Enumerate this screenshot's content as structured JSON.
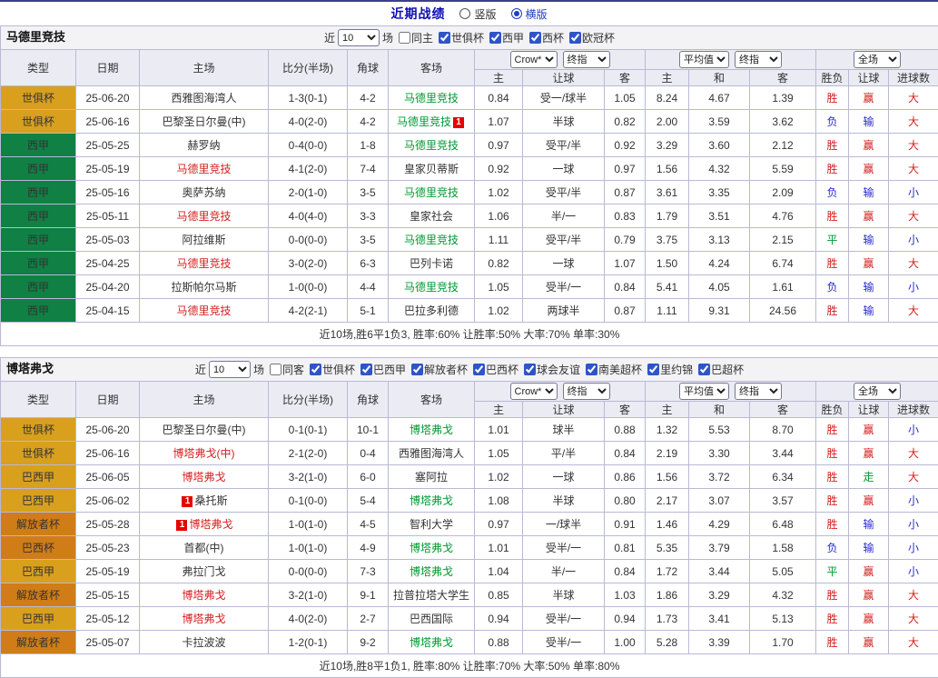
{
  "page": {
    "title": "近期战绩",
    "views": [
      {
        "label": "竖版",
        "selected": false
      },
      {
        "label": "横版",
        "selected": true
      }
    ]
  },
  "header": {
    "col_labels": [
      "类型",
      "日期",
      "主场",
      "比分(半场)",
      "角球",
      "客场"
    ],
    "sub_labels": [
      "主",
      "让球",
      "客",
      "主",
      "和",
      "客",
      "胜负",
      "让球",
      "进球数"
    ],
    "select_groups": [
      [
        "Crow*",
        "终指"
      ],
      [
        "平均值",
        "终指"
      ],
      [
        "全场"
      ]
    ]
  },
  "colors": {
    "type": {
      "世俱杯": "#d8a01d",
      "西甲": "#108044",
      "巴西甲": "#d8a01d",
      "解放者杯": "#d07d18",
      "巴西杯": "#d07d18"
    },
    "team": {
      "red": "#d42020",
      "green": "#009933",
      "black": "#333333"
    },
    "mark": {
      "red": "#d42020",
      "blue": "#2929cc",
      "green": "#009933"
    },
    "marks": {
      "胜": "red",
      "平": "green",
      "负": "blue",
      "赢": "red",
      "输": "blue",
      "走": "green",
      "大": "red",
      "小": "blue"
    }
  },
  "tables": [
    {
      "team": "马德里竞技",
      "filter": {
        "near": "近",
        "count": "10",
        "games": "场",
        "same": {
          "label": "同主",
          "checked": false
        },
        "competitions": [
          {
            "label": "世俱杯",
            "checked": true
          },
          {
            "label": "西甲",
            "checked": true
          },
          {
            "label": "西杯",
            "checked": true
          },
          {
            "label": "欧冠杯",
            "checked": true
          }
        ]
      },
      "rows": [
        {
          "type": "世俱杯",
          "date": "25-06-20",
          "home": {
            "name": "西雅图海湾人",
            "color": "black"
          },
          "score": "1-3(0-1)",
          "corner": "4-2",
          "away": {
            "name": "马德里竞技",
            "color": "green"
          },
          "odds1": [
            "0.84",
            "受一/球半",
            "1.05"
          ],
          "odds2": [
            "8.24",
            "4.67",
            "1.39"
          ],
          "result": "胜",
          "cover": "赢",
          "goals": "大"
        },
        {
          "type": "世俱杯",
          "date": "25-06-16",
          "home": {
            "name": "巴黎圣日尔曼(中)",
            "color": "black"
          },
          "score": "4-0(2-0)",
          "corner": "4-2",
          "away": {
            "name": "马德里竞技",
            "color": "green",
            "badge_after": "1"
          },
          "odds1": [
            "1.07",
            "半球",
            "0.82"
          ],
          "odds2": [
            "2.00",
            "3.59",
            "3.62"
          ],
          "result": "负",
          "cover": "输",
          "goals": "大"
        },
        {
          "type": "西甲",
          "date": "25-05-25",
          "home": {
            "name": "赫罗纳",
            "color": "black"
          },
          "score": "0-4(0-0)",
          "corner": "1-8",
          "away": {
            "name": "马德里竞技",
            "color": "green"
          },
          "odds1": [
            "0.97",
            "受平/半",
            "0.92"
          ],
          "odds2": [
            "3.29",
            "3.60",
            "2.12"
          ],
          "result": "胜",
          "cover": "赢",
          "goals": "大"
        },
        {
          "type": "西甲",
          "date": "25-05-19",
          "home": {
            "name": "马德里竞技",
            "color": "red"
          },
          "score": "4-1(2-0)",
          "corner": "7-4",
          "away": {
            "name": "皇家贝蒂斯",
            "color": "black"
          },
          "odds1": [
            "0.92",
            "一球",
            "0.97"
          ],
          "odds2": [
            "1.56",
            "4.32",
            "5.59"
          ],
          "result": "胜",
          "cover": "赢",
          "goals": "大"
        },
        {
          "type": "西甲",
          "date": "25-05-16",
          "home": {
            "name": "奥萨苏纳",
            "color": "black"
          },
          "score": "2-0(1-0)",
          "corner": "3-5",
          "away": {
            "name": "马德里竞技",
            "color": "green"
          },
          "odds1": [
            "1.02",
            "受平/半",
            "0.87"
          ],
          "odds2": [
            "3.61",
            "3.35",
            "2.09"
          ],
          "result": "负",
          "cover": "输",
          "goals": "小"
        },
        {
          "type": "西甲",
          "date": "25-05-11",
          "home": {
            "name": "马德里竞技",
            "color": "red"
          },
          "score": "4-0(4-0)",
          "corner": "3-3",
          "away": {
            "name": "皇家社会",
            "color": "black"
          },
          "odds1": [
            "1.06",
            "半/一",
            "0.83"
          ],
          "odds2": [
            "1.79",
            "3.51",
            "4.76"
          ],
          "result": "胜",
          "cover": "赢",
          "goals": "大"
        },
        {
          "type": "西甲",
          "date": "25-05-03",
          "home": {
            "name": "阿拉维斯",
            "color": "black"
          },
          "score": "0-0(0-0)",
          "corner": "3-5",
          "away": {
            "name": "马德里竞技",
            "color": "green"
          },
          "odds1": [
            "1.11",
            "受平/半",
            "0.79"
          ],
          "odds2": [
            "3.75",
            "3.13",
            "2.15"
          ],
          "result": "平",
          "cover": "输",
          "goals": "小"
        },
        {
          "type": "西甲",
          "date": "25-04-25",
          "home": {
            "name": "马德里竞技",
            "color": "red"
          },
          "score": "3-0(2-0)",
          "corner": "6-3",
          "away": {
            "name": "巴列卡诺",
            "color": "black"
          },
          "odds1": [
            "0.82",
            "一球",
            "1.07"
          ],
          "odds2": [
            "1.50",
            "4.24",
            "6.74"
          ],
          "result": "胜",
          "cover": "赢",
          "goals": "大"
        },
        {
          "type": "西甲",
          "date": "25-04-20",
          "home": {
            "name": "拉斯帕尔马斯",
            "color": "black"
          },
          "score": "1-0(0-0)",
          "corner": "4-4",
          "away": {
            "name": "马德里竞技",
            "color": "green"
          },
          "odds1": [
            "1.05",
            "受半/一",
            "0.84"
          ],
          "odds2": [
            "5.41",
            "4.05",
            "1.61"
          ],
          "result": "负",
          "cover": "输",
          "goals": "小"
        },
        {
          "type": "西甲",
          "date": "25-04-15",
          "home": {
            "name": "马德里竞技",
            "color": "red"
          },
          "score": "4-2(2-1)",
          "corner": "5-1",
          "away": {
            "name": "巴拉多利德",
            "color": "black"
          },
          "odds1": [
            "1.02",
            "两球半",
            "0.87"
          ],
          "odds2": [
            "1.11",
            "9.31",
            "24.56"
          ],
          "result": "胜",
          "cover": "输",
          "goals": "大"
        }
      ],
      "summary": "近10场,胜6平1负3, 胜率:60% 让胜率:50% 大率:70% 单率:30%"
    },
    {
      "team": "博塔弗戈",
      "filter": {
        "near": "近",
        "count": "10",
        "games": "场",
        "same": {
          "label": "同客",
          "checked": false
        },
        "competitions": [
          {
            "label": "世俱杯",
            "checked": true
          },
          {
            "label": "巴西甲",
            "checked": true
          },
          {
            "label": "解放者杯",
            "checked": true
          },
          {
            "label": "巴西杯",
            "checked": true
          },
          {
            "label": "球会友谊",
            "checked": true
          },
          {
            "label": "南美超杯",
            "checked": true
          },
          {
            "label": "里约锦",
            "checked": true
          },
          {
            "label": "巴超杯",
            "checked": true
          }
        ]
      },
      "rows": [
        {
          "type": "世俱杯",
          "date": "25-06-20",
          "home": {
            "name": "巴黎圣日尔曼(中)",
            "color": "black"
          },
          "score": "0-1(0-1)",
          "corner": "10-1",
          "away": {
            "name": "博塔弗戈",
            "color": "green"
          },
          "odds1": [
            "1.01",
            "球半",
            "0.88"
          ],
          "odds2": [
            "1.32",
            "5.53",
            "8.70"
          ],
          "result": "胜",
          "cover": "赢",
          "goals": "小"
        },
        {
          "type": "世俱杯",
          "date": "25-06-16",
          "home": {
            "name": "博塔弗戈(中)",
            "color": "red"
          },
          "score": "2-1(2-0)",
          "corner": "0-4",
          "away": {
            "name": "西雅图海湾人",
            "color": "black"
          },
          "odds1": [
            "1.05",
            "平/半",
            "0.84"
          ],
          "odds2": [
            "2.19",
            "3.30",
            "3.44"
          ],
          "result": "胜",
          "cover": "赢",
          "goals": "大"
        },
        {
          "type": "巴西甲",
          "date": "25-06-05",
          "home": {
            "name": "博塔弗戈",
            "color": "red"
          },
          "score": "3-2(1-0)",
          "corner": "6-0",
          "away": {
            "name": "塞阿拉",
            "color": "black"
          },
          "odds1": [
            "1.02",
            "一球",
            "0.86"
          ],
          "odds2": [
            "1.56",
            "3.72",
            "6.34"
          ],
          "result": "胜",
          "cover": "走",
          "goals": "大"
        },
        {
          "type": "巴西甲",
          "date": "25-06-02",
          "home": {
            "name": "桑托斯",
            "color": "black",
            "badge_before": "1"
          },
          "score": "0-1(0-0)",
          "corner": "5-4",
          "away": {
            "name": "博塔弗戈",
            "color": "green"
          },
          "odds1": [
            "1.08",
            "半球",
            "0.80"
          ],
          "odds2": [
            "2.17",
            "3.07",
            "3.57"
          ],
          "result": "胜",
          "cover": "赢",
          "goals": "小"
        },
        {
          "type": "解放者杯",
          "date": "25-05-28",
          "home": {
            "name": "博塔弗戈",
            "color": "red",
            "badge_before": "1"
          },
          "score": "1-0(1-0)",
          "corner": "4-5",
          "away": {
            "name": "智利大学",
            "color": "black"
          },
          "odds1": [
            "0.97",
            "一/球半",
            "0.91"
          ],
          "odds2": [
            "1.46",
            "4.29",
            "6.48"
          ],
          "result": "胜",
          "cover": "输",
          "goals": "小"
        },
        {
          "type": "巴西杯",
          "date": "25-05-23",
          "home": {
            "name": "首都(中)",
            "color": "black"
          },
          "score": "1-0(1-0)",
          "corner": "4-9",
          "away": {
            "name": "博塔弗戈",
            "color": "green"
          },
          "odds1": [
            "1.01",
            "受半/一",
            "0.81"
          ],
          "odds2": [
            "5.35",
            "3.79",
            "1.58"
          ],
          "result": "负",
          "cover": "输",
          "goals": "小"
        },
        {
          "type": "巴西甲",
          "date": "25-05-19",
          "home": {
            "name": "弗拉门戈",
            "color": "black"
          },
          "score": "0-0(0-0)",
          "corner": "7-3",
          "away": {
            "name": "博塔弗戈",
            "color": "green"
          },
          "odds1": [
            "1.04",
            "半/一",
            "0.84"
          ],
          "odds2": [
            "1.72",
            "3.44",
            "5.05"
          ],
          "result": "平",
          "cover": "赢",
          "goals": "小"
        },
        {
          "type": "解放者杯",
          "date": "25-05-15",
          "home": {
            "name": "博塔弗戈",
            "color": "red"
          },
          "score": "3-2(1-0)",
          "corner": "9-1",
          "away": {
            "name": "拉普拉塔大学生",
            "color": "black"
          },
          "odds1": [
            "0.85",
            "半球",
            "1.03"
          ],
          "odds2": [
            "1.86",
            "3.29",
            "4.32"
          ],
          "result": "胜",
          "cover": "赢",
          "goals": "大"
        },
        {
          "type": "巴西甲",
          "date": "25-05-12",
          "home": {
            "name": "博塔弗戈",
            "color": "red"
          },
          "score": "4-0(2-0)",
          "corner": "2-7",
          "away": {
            "name": "巴西国际",
            "color": "black"
          },
          "odds1": [
            "0.94",
            "受半/一",
            "0.94"
          ],
          "odds2": [
            "1.73",
            "3.41",
            "5.13"
          ],
          "result": "胜",
          "cover": "赢",
          "goals": "大"
        },
        {
          "type": "解放者杯",
          "date": "25-05-07",
          "home": {
            "name": "卡拉波波",
            "color": "black"
          },
          "score": "1-2(0-1)",
          "corner": "9-2",
          "away": {
            "name": "博塔弗戈",
            "color": "green"
          },
          "odds1": [
            "0.88",
            "受半/一",
            "1.00"
          ],
          "odds2": [
            "5.28",
            "3.39",
            "1.70"
          ],
          "result": "胜",
          "cover": "赢",
          "goals": "大"
        }
      ],
      "summary": "近10场,胜8平1负1, 胜率:80% 让胜率:70% 大率:50% 单率:80%"
    }
  ]
}
